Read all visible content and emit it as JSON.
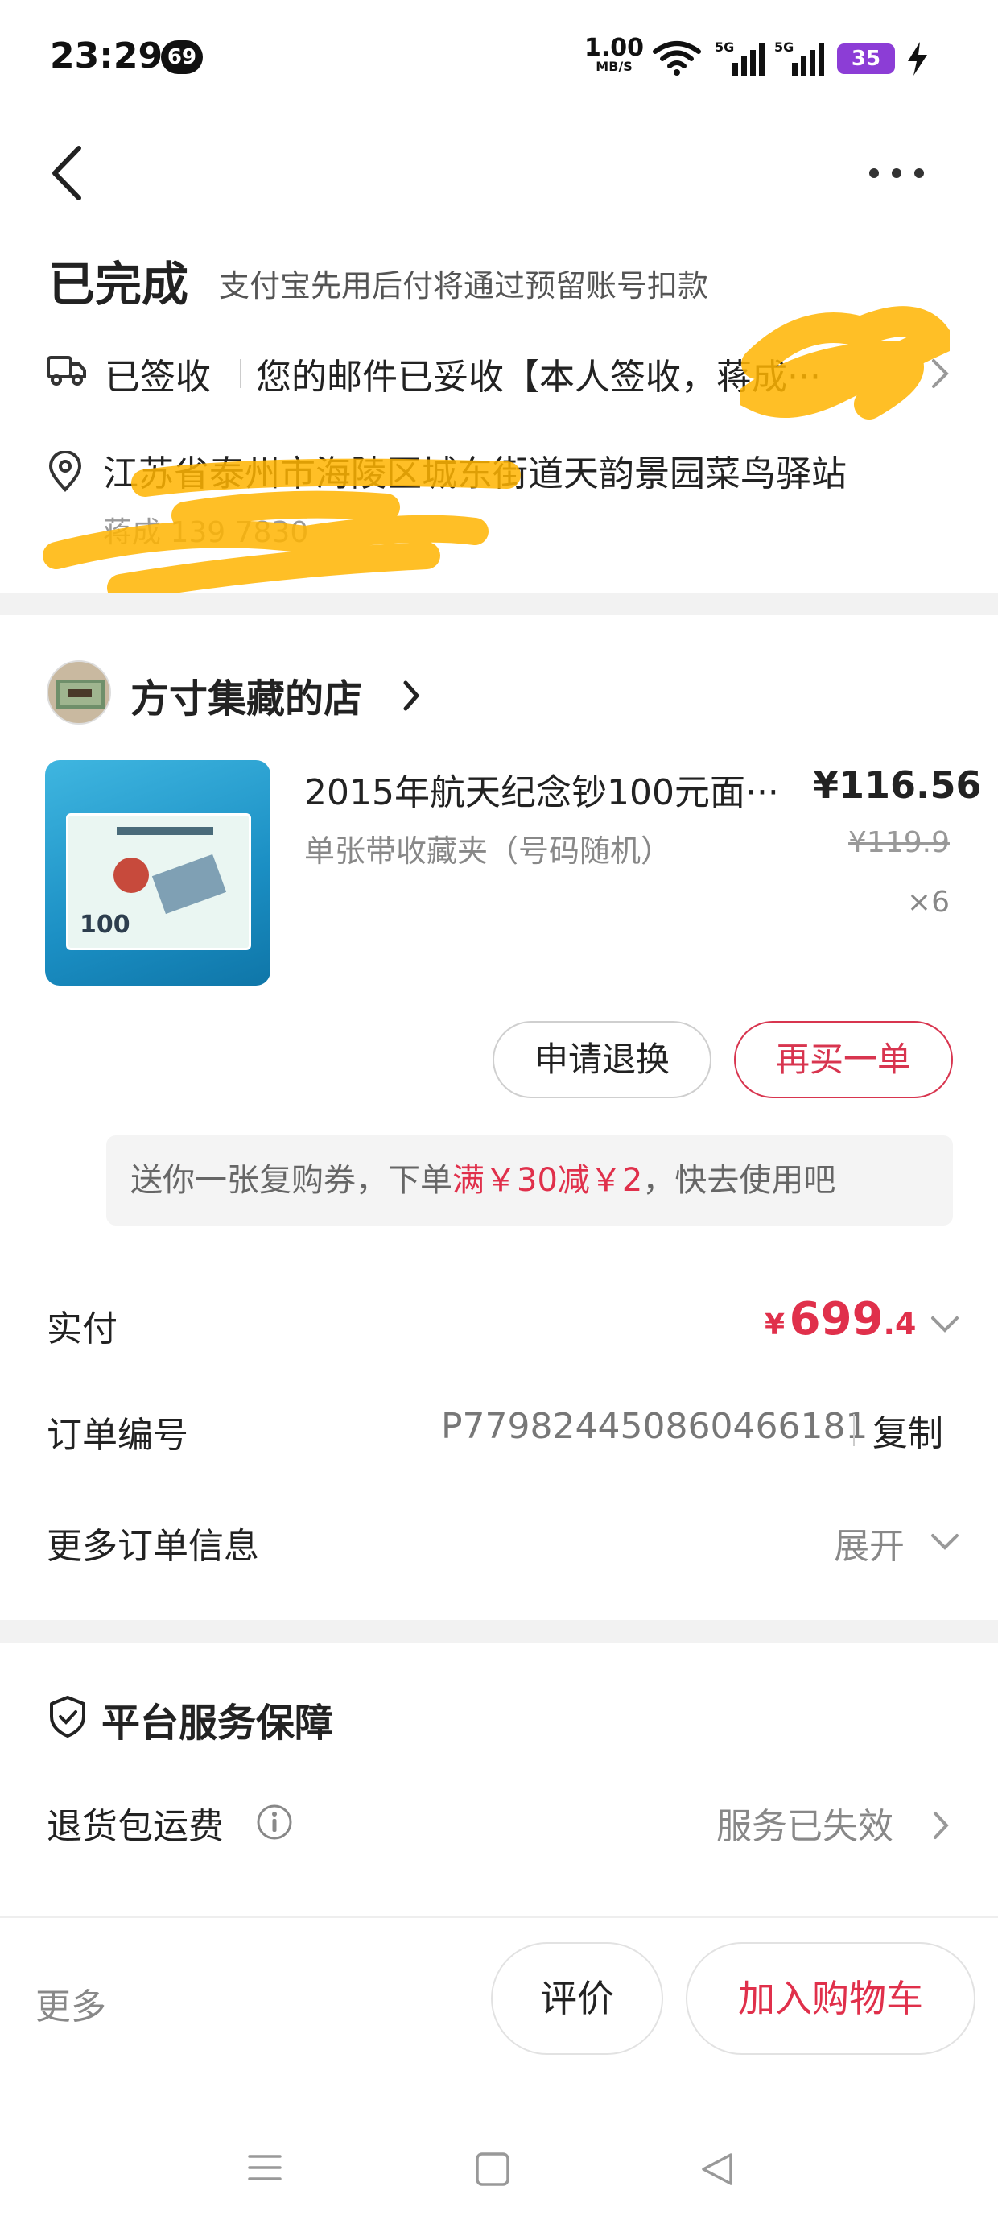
{
  "status_bar": {
    "time": "23:29",
    "notification_count": "69",
    "net_speed": "1.00",
    "net_unit": "MB/S",
    "battery": "35",
    "signal_label_1": "5G",
    "signal_label_2": "5G"
  },
  "order": {
    "status": "已完成",
    "status_sub": "支付宝先用后付将通过预留账号扣款"
  },
  "logistics": {
    "status": "已签收",
    "text": "您的邮件已妥收【本人签收，蒋成···"
  },
  "address": {
    "text": "江苏省泰州市海陵区城东街道天韵景园菜鸟驿站",
    "recipient": "蒋成 139 7830"
  },
  "shop": {
    "name": "方寸集藏的店"
  },
  "product": {
    "title": "2015年航天纪念钞100元面···",
    "price": "¥116.56",
    "spec": "单张带收藏夹（号码随机）",
    "original_price": "¥119.9",
    "quantity": "×6",
    "note_denomination": "100"
  },
  "actions": {
    "refund": "申请退换",
    "rebuy": "再买一单"
  },
  "coupon": {
    "prefix": "送你一张复购券，下单",
    "highlight": "满￥30减￥2",
    "suffix": "，快去使用吧"
  },
  "info": {
    "paid_label": "实付",
    "paid_currency": "¥",
    "paid_integer": "699",
    "paid_decimal": ".4",
    "order_no_label": "订单编号",
    "order_no": "P779824450860466181",
    "copy": "复制",
    "more_info_label": "更多订单信息",
    "expand": "展开"
  },
  "guarantee": {
    "title": "平台服务保障",
    "return_label": "退货包运费",
    "service_status": "服务已失效"
  },
  "bottom_bar": {
    "more": "更多",
    "review": "评价",
    "add_to_cart": "加入购物车"
  },
  "colors": {
    "accent_red": "#e0304b",
    "battery_purple": "#8c3dd6",
    "redaction_yellow": "#ffb400"
  }
}
